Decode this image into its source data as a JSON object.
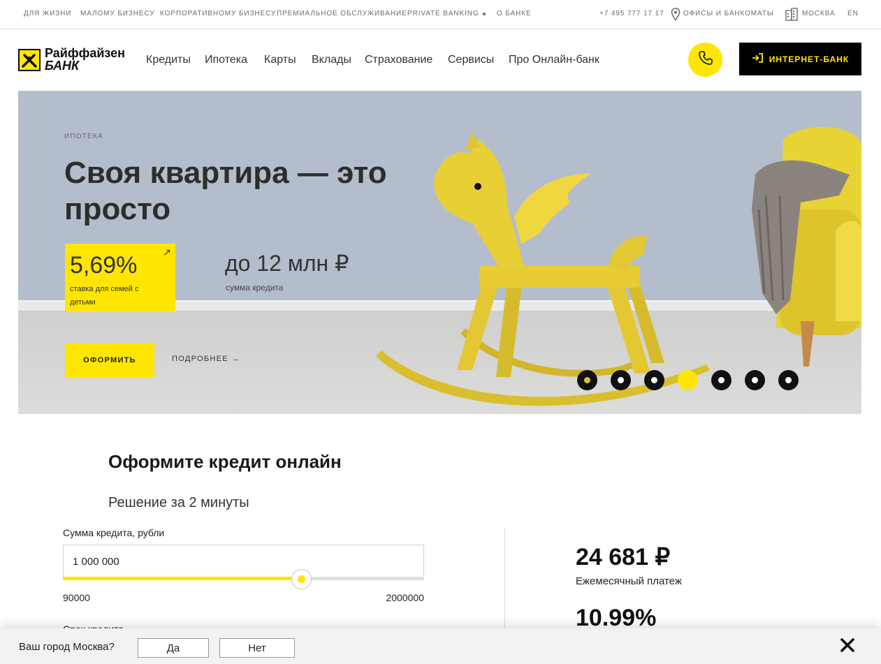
{
  "topbar": {
    "links": [
      "ДЛЯ ЖИЗНИ",
      "МАЛОМУ БИЗНЕСУ",
      "КОРПОРАТИВНОМУ БИЗНЕСУ",
      "ПРЕМИАЛЬНОЕ ОБСЛУЖИВАНИЕ",
      "PRIVATE BANKING",
      "О БАНКЕ"
    ],
    "phone": "+7 495 777 17 17",
    "offices": "ОФИСЫ  И  БАНКОМАТЫ",
    "city": "МОСКВА",
    "lang": "EN"
  },
  "header": {
    "logo_line1": "Райффайзен",
    "logo_line2": "БАНК",
    "nav": [
      "Кредиты",
      "Ипотека",
      "Карты",
      "Вклады",
      "Страхование",
      "Сервисы",
      "Про Онлайн-банк"
    ],
    "internet_bank": "ИНТЕРНЕТ-БАНК"
  },
  "hero": {
    "crumb": "ИПОТЕКА",
    "title": "Своя квартира — это просто",
    "rate_value": "5,69%",
    "rate_label": "ставка для семей с детьми",
    "amount_value": "до 12 млн ₽",
    "amount_label": "сумма кредита",
    "apply": "ОФОРМИТЬ",
    "more": "ПОДРОБНЕЕ →",
    "slide_count": 7,
    "active_slide": 4
  },
  "calculator": {
    "title": "Оформите кредит онлайн",
    "subtitle": "Решение за 2 минуты",
    "amount_label": "Сумма кредита, рубли",
    "amount_value": "1 000 000",
    "slider_min": "90000",
    "slider_max": "2000000",
    "slider_fill_fraction": 0.66,
    "term_label": "Срок кредита",
    "monthly_payment": "24 681 ₽",
    "monthly_payment_label": "Ежемесячный платеж",
    "rate": "10.99%"
  },
  "city_prompt": {
    "question": "Ваш город Москва?",
    "yes": "Да",
    "no": "Нет"
  },
  "colors": {
    "brand_yellow": "#fee600",
    "black": "#000000",
    "hero_wall": "#b4bdcc"
  }
}
